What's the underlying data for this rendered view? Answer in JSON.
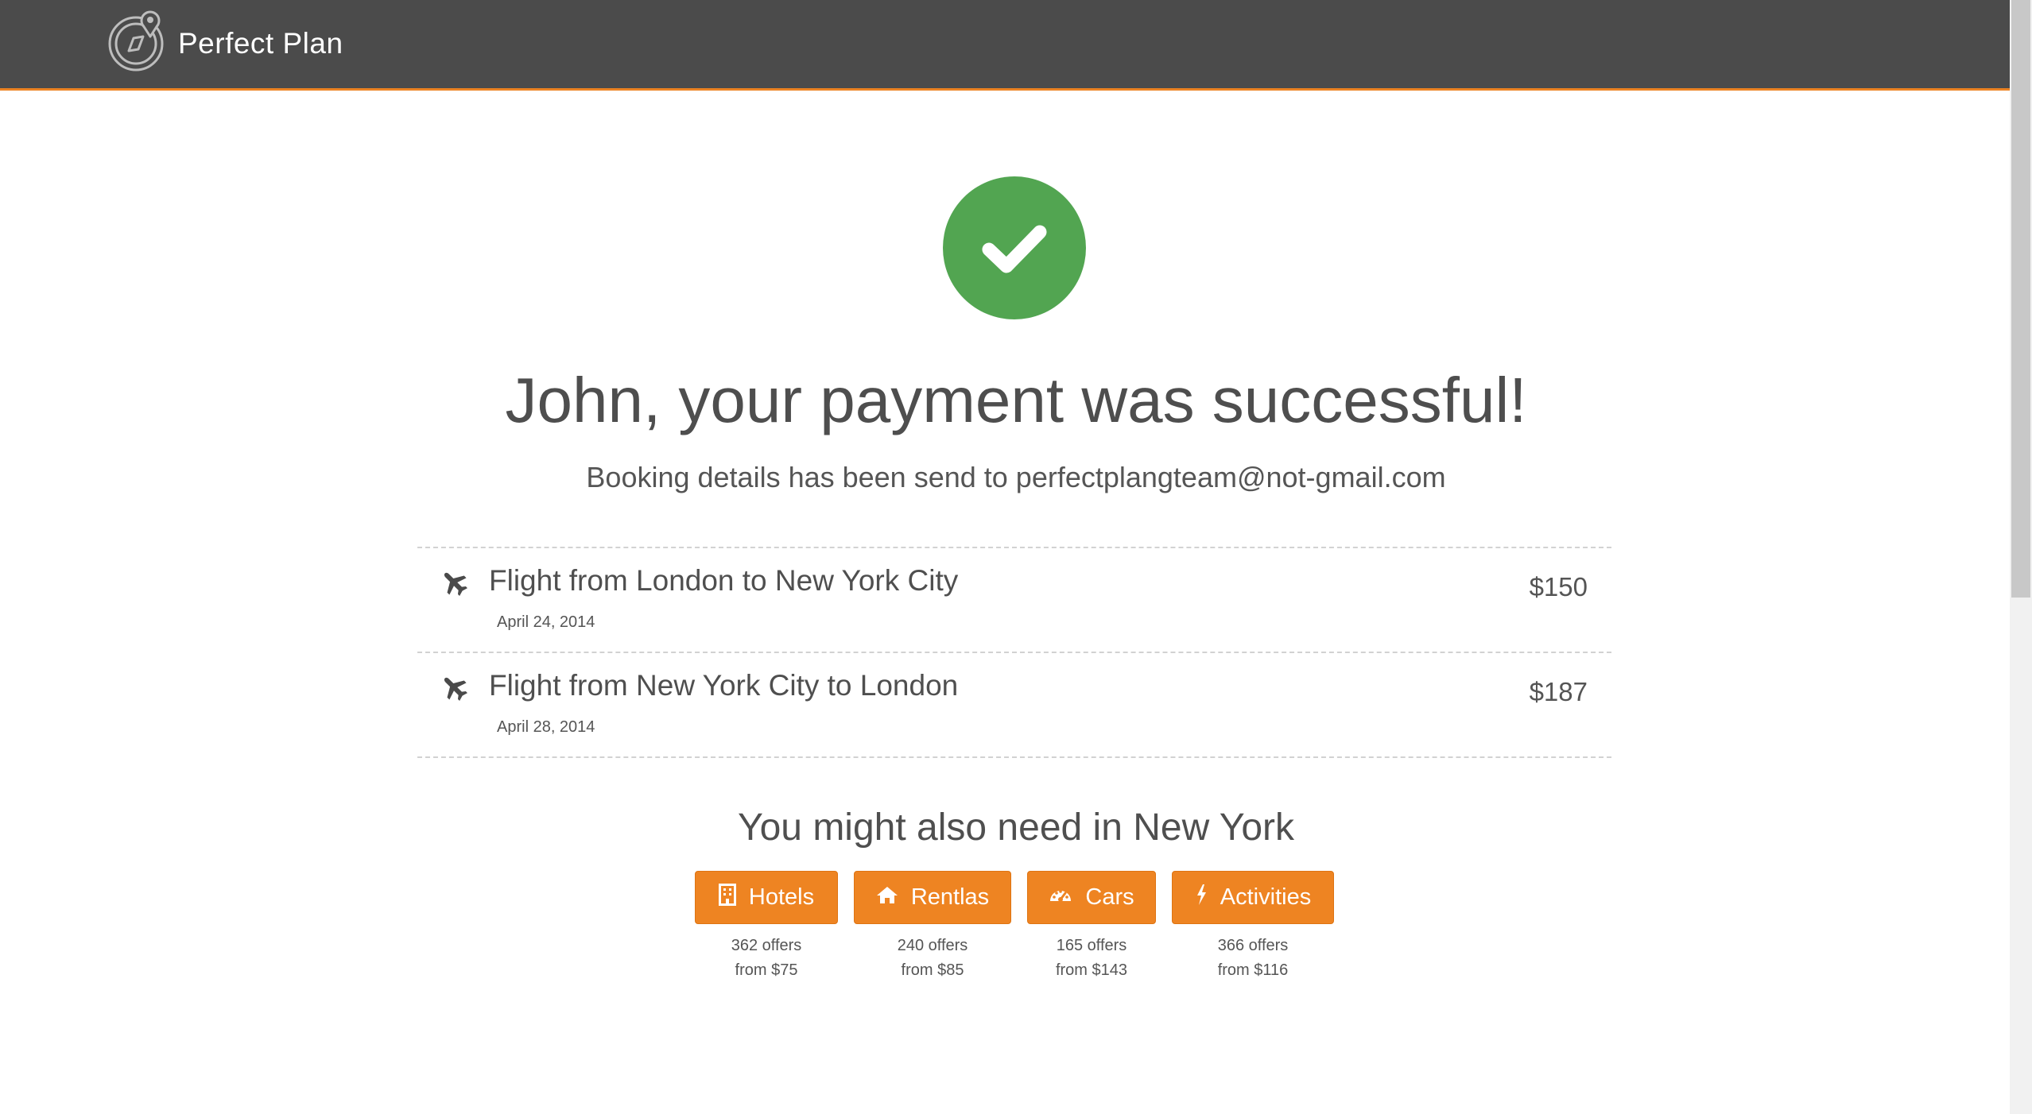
{
  "app": {
    "name": "Perfect Plan"
  },
  "confirmation": {
    "headline": "John, your payment was successful!",
    "subline": "Booking details has been send to perfectplangteam@not-gmail.com"
  },
  "bookings": [
    {
      "icon": "airplane-icon",
      "title": "Flight from London to New York City",
      "date": "April 24, 2014",
      "price": "$150"
    },
    {
      "icon": "airplane-icon",
      "title": "Flight from New York City to London",
      "date": "April 28, 2014",
      "price": "$187"
    }
  ],
  "suggestions": {
    "title": "You might also need in New York",
    "items": [
      {
        "icon": "building-icon",
        "label": "Hotels",
        "offers": "362 offers",
        "from": "from $75"
      },
      {
        "icon": "home-icon",
        "label": "Rentlas",
        "offers": "240 offers",
        "from": "from $85"
      },
      {
        "icon": "dashboard-icon",
        "label": "Cars",
        "offers": "165 offers",
        "from": "from $143"
      },
      {
        "icon": "lightning-icon",
        "label": "Activities",
        "offers": "366 offers",
        "from": "from $116"
      }
    ]
  },
  "colors": {
    "header_bg": "#4b4b4b",
    "accent": "#ee8422",
    "success": "#52a551"
  }
}
